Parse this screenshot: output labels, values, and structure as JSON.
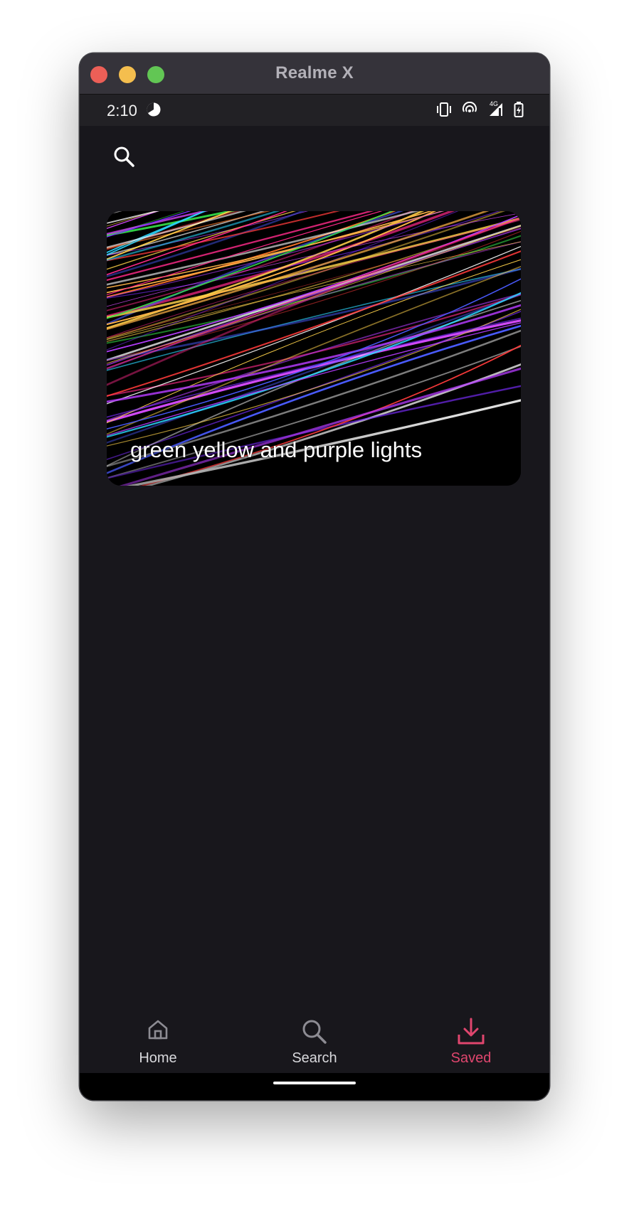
{
  "window": {
    "title": "Realme X"
  },
  "status_bar": {
    "time": "2:10",
    "icons": [
      "theme-icon",
      "vibrate-icon",
      "hotspot-icon",
      "signal-icon",
      "battery-icon"
    ],
    "signal_label": "4G"
  },
  "search": {
    "icon": "search-icon"
  },
  "saved_items": [
    {
      "title": "green yellow and purple lights"
    }
  ],
  "bottom_nav": {
    "items": [
      {
        "label": "Home",
        "icon": "home-icon"
      },
      {
        "label": "Search",
        "icon": "search-icon"
      },
      {
        "label": "Saved",
        "icon": "download-icon"
      }
    ],
    "active": "Saved"
  },
  "colors": {
    "accent": "#e0466e",
    "background": "#18171c",
    "titlebar": "#35333a"
  }
}
